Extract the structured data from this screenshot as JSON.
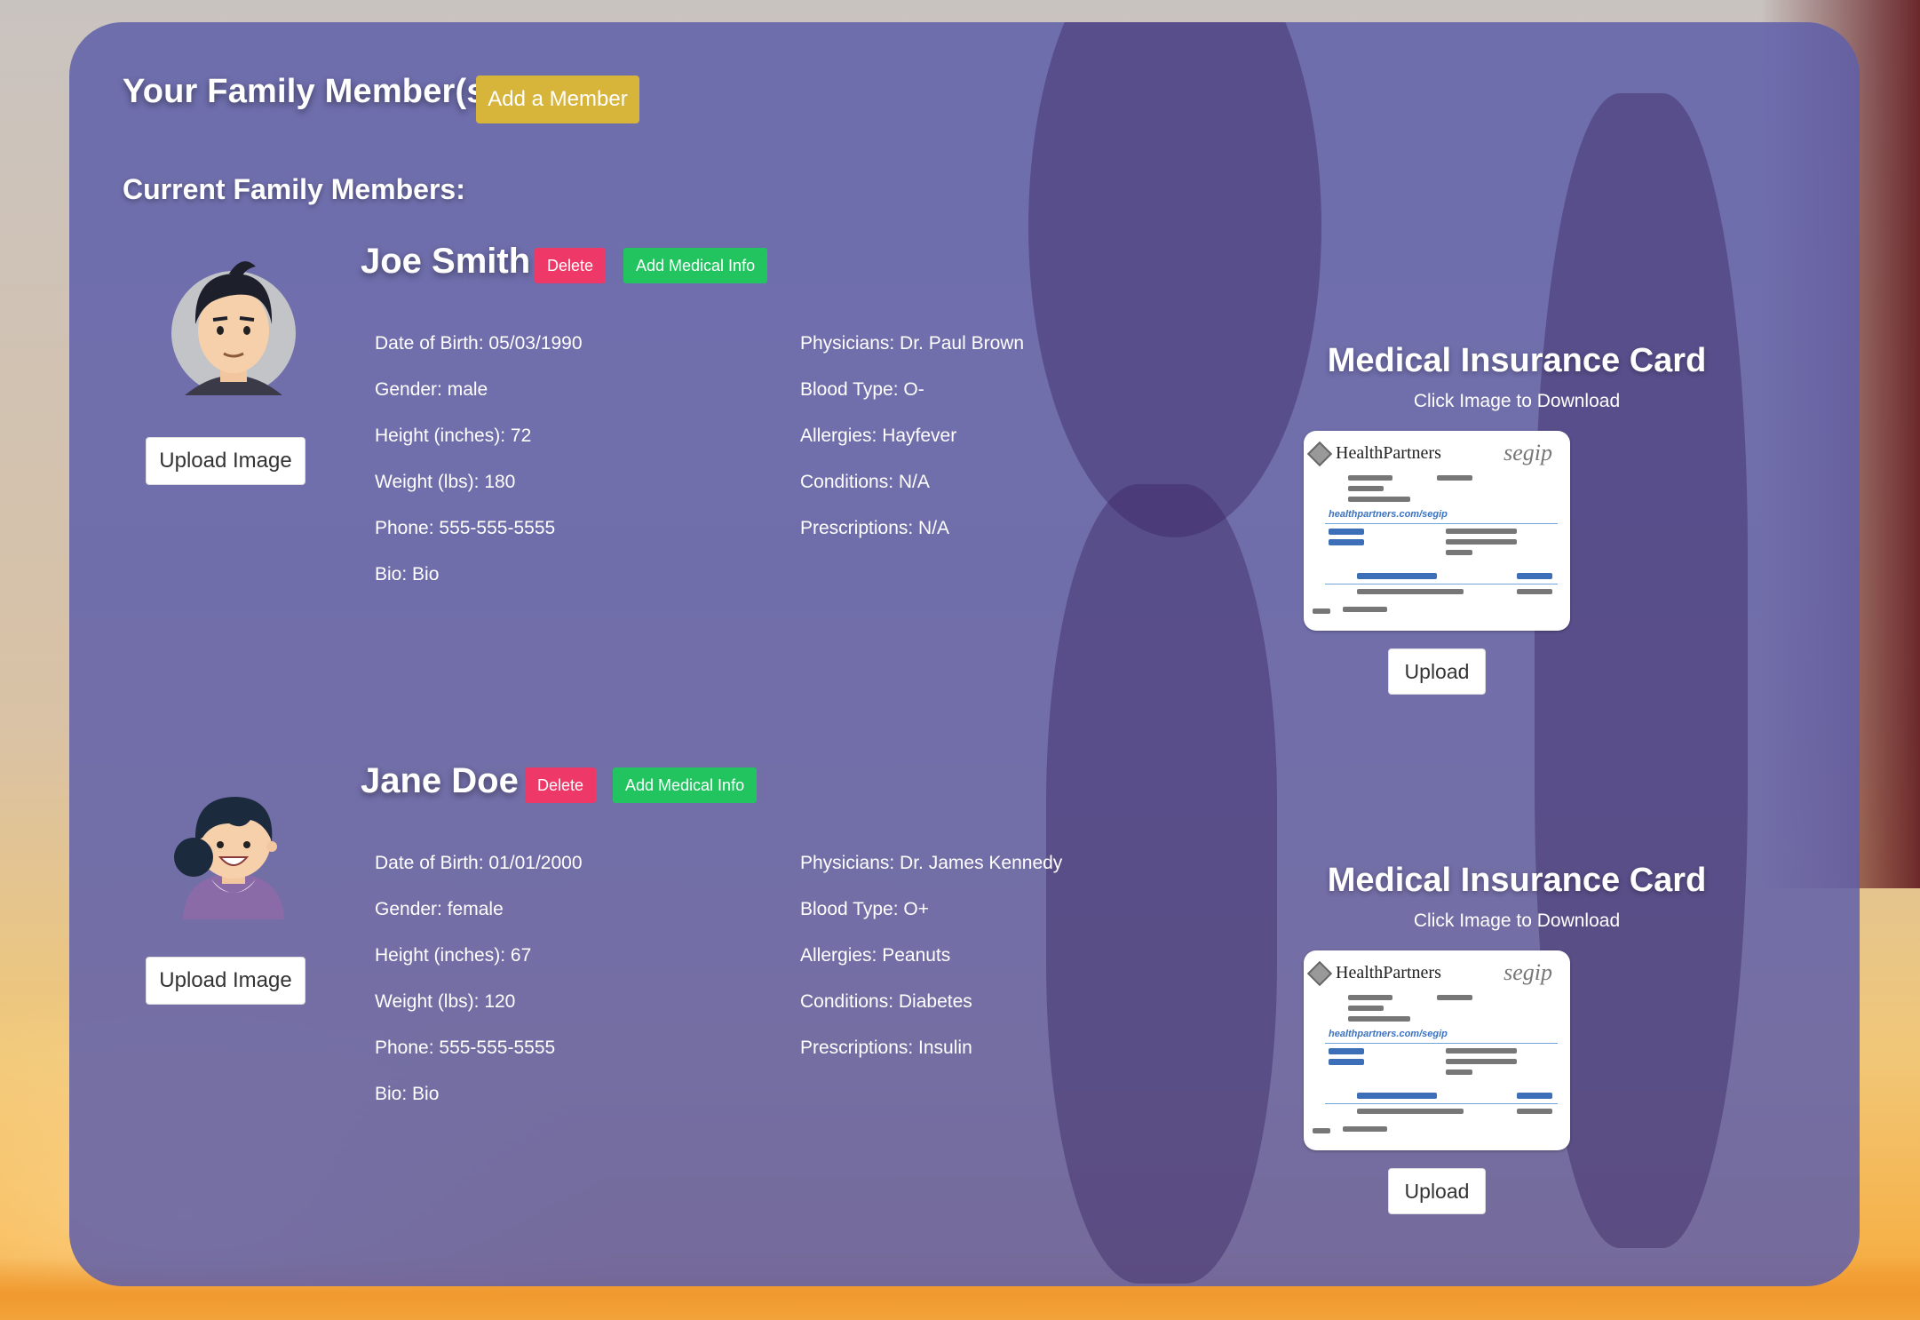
{
  "header": {
    "title": "Your Family Member(s)",
    "add_member_label": "Add a Member"
  },
  "section": {
    "title": "Current Family Members:"
  },
  "buttons": {
    "delete_label": "Delete",
    "add_medical_label": "Add Medical Info",
    "upload_image_label": "Upload Image",
    "upload_label": "Upload"
  },
  "insurance": {
    "title": "Medical Insurance Card",
    "subtitle": "Click Image to Download"
  },
  "members": [
    {
      "name": "Joe Smith",
      "avatar": "male-avatar",
      "left": [
        "Date of Birth: 05/03/1990",
        "Gender: male",
        "Height (inches): 72",
        "Weight (lbs): 180",
        "Phone: 555-555-5555",
        "Bio: Bio"
      ],
      "right": [
        "Physicians: Dr. Paul Brown",
        "Blood Type: O-",
        "Allergies: Hayfever",
        "Conditions: N/A",
        "Prescriptions: N/A"
      ]
    },
    {
      "name": "Jane Doe",
      "avatar": "female-avatar",
      "left": [
        "Date of Birth: 01/01/2000",
        "Gender: female",
        "Height (inches): 67",
        "Weight (lbs): 120",
        "Phone: 555-555-5555",
        "Bio: Bio"
      ],
      "right": [
        "Physicians: Dr. James Kennedy",
        "Blood Type: O+",
        "Allergies: Peanuts",
        "Conditions: Diabetes",
        "Prescriptions: Insulin"
      ]
    }
  ],
  "card": {
    "brand": "HealthPartners",
    "logo": "segip",
    "url": "healthpartners.com/segip"
  },
  "colors": {
    "panel": "#5f5faa",
    "add_member": "#d7b43a",
    "delete": "#ee3968",
    "medical": "#22c460"
  }
}
